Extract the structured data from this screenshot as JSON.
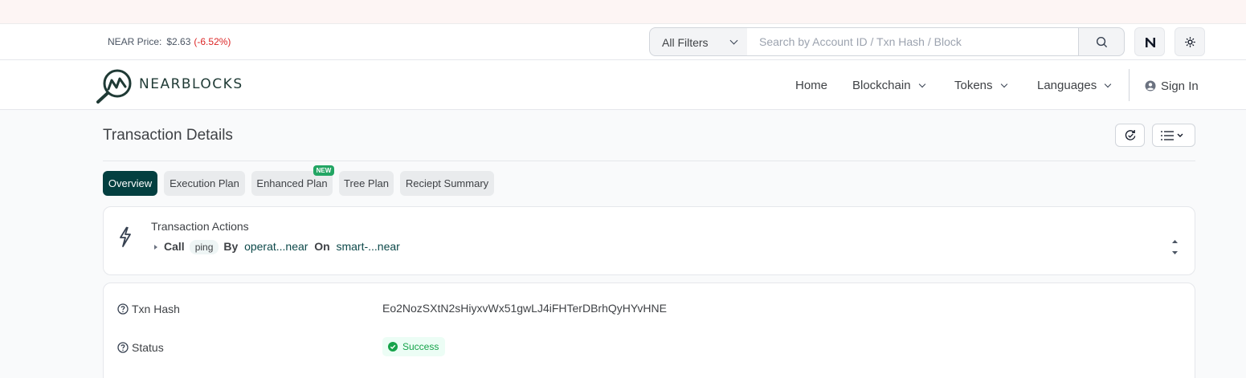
{
  "topbar": {
    "price_label": "NEAR Price:",
    "price_value": "$2.63",
    "price_change": "(-6.52%)",
    "filter_label": "All Filters",
    "search_placeholder": "Search by Account ID / Txn Hash / Block"
  },
  "nav": {
    "logo_text": "NEARBLOCKS",
    "items": [
      {
        "label": "Home"
      },
      {
        "label": "Blockchain"
      },
      {
        "label": "Tokens"
      },
      {
        "label": "Languages"
      }
    ],
    "signin": "Sign In"
  },
  "page": {
    "title": "Transaction Details"
  },
  "tabs": [
    {
      "label": "Overview",
      "active": true
    },
    {
      "label": "Execution Plan"
    },
    {
      "label": "Enhanced Plan",
      "badge": "NEW"
    },
    {
      "label": "Tree Plan"
    },
    {
      "label": "Reciept Summary"
    }
  ],
  "actions": {
    "title": "Transaction Actions",
    "verb": "Call",
    "method": "ping",
    "by_label": "By",
    "from": "operat...near",
    "on_label": "On",
    "to": "smart-...near"
  },
  "details": {
    "hash_label": "Txn Hash",
    "hash_value": "Eo2NozSXtN2sHiyxvWx51gwLJ4iFHTerDBrhQyHYvHNE",
    "status_label": "Status",
    "status_value": "Success"
  },
  "colors": {
    "brand": "#033f40",
    "negative": "#dc2626",
    "success": "#16a34a",
    "badge_new": "#22a563"
  }
}
